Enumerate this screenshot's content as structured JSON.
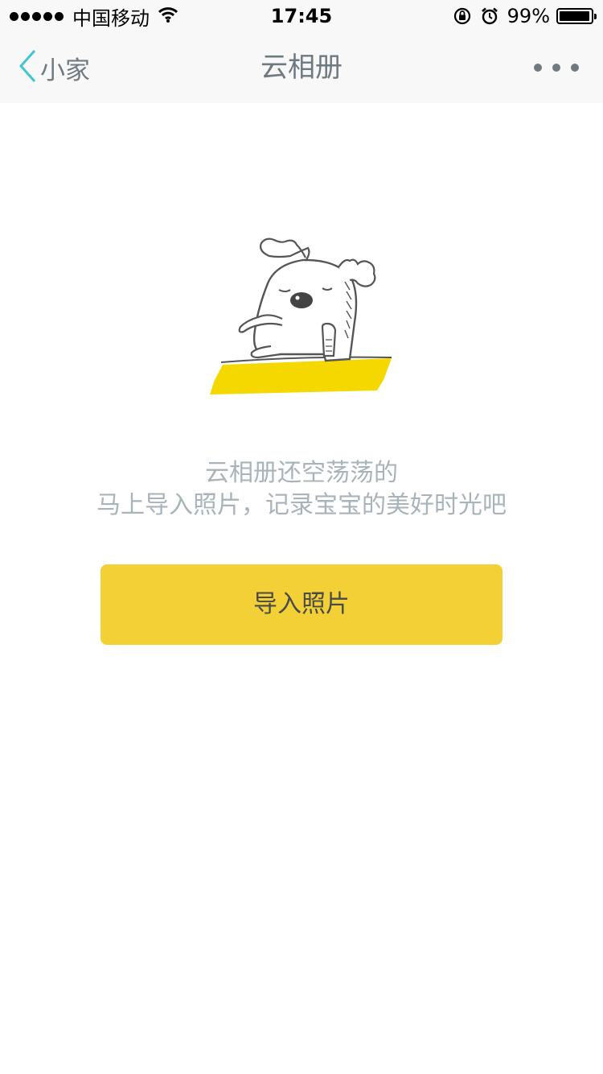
{
  "status_bar": {
    "carrier": "中国移动",
    "time": "17:45",
    "battery_percent": "99%",
    "icons": [
      "signal-dots-icon",
      "wifi-icon",
      "orientation-lock-icon",
      "alarm-icon",
      "battery-icon"
    ]
  },
  "nav": {
    "back_label": "小家",
    "title": "云相册",
    "more_icon": "more-dots-icon",
    "accent_color": "#3fc6d0"
  },
  "empty_state": {
    "illustration": "moose-sitting-illustration",
    "line1": "云相册还空荡荡的",
    "line2": "马上导入照片，记录宝宝的美好时光吧",
    "button_label": "导入照片",
    "button_color": "#f3d136"
  }
}
